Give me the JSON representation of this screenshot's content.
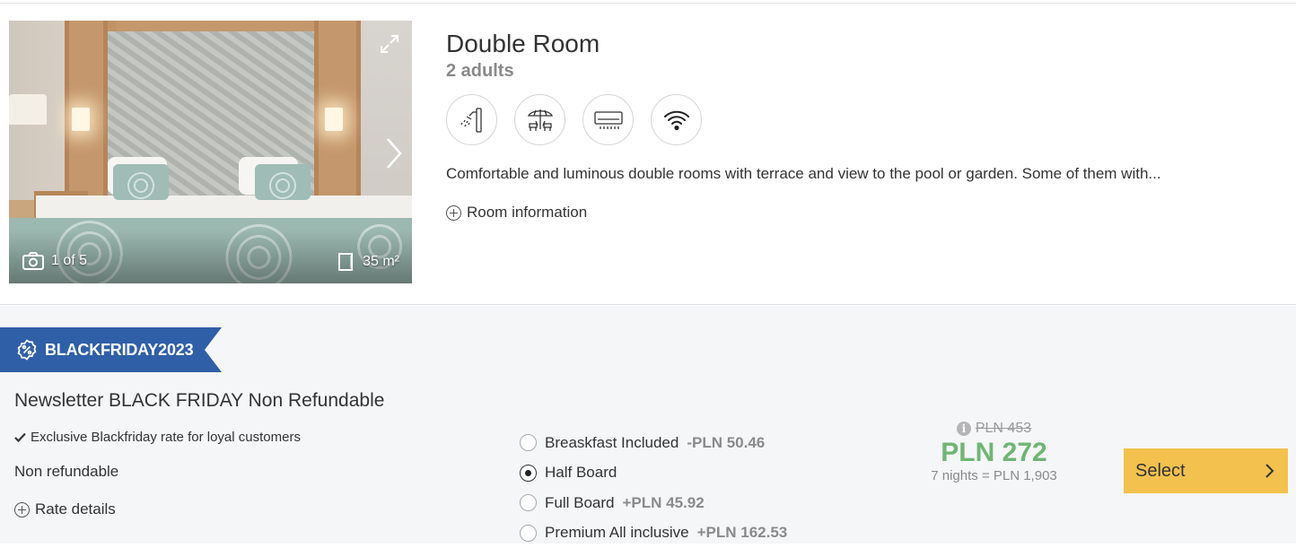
{
  "room": {
    "title": "Double Room",
    "occupancy": "2 adults",
    "gallery": {
      "counter": "1 of 5",
      "area": "35 m²"
    },
    "amenities": [
      "shower-icon",
      "terrace-icon",
      "air-conditioning-icon",
      "wifi-icon"
    ],
    "description": "Comfortable and luminous double rooms with terrace and view to the pool or garden.  Some of them with...",
    "info_link": "Room information"
  },
  "rate": {
    "promo_code": "BLACKFRIDAY2023",
    "promo_color": "#2f5fa7",
    "title": "Newsletter BLACK FRIDAY Non Refundable",
    "feature": "Exclusive Blackfriday rate for loyal customers",
    "policy": "Non refundable",
    "details_link": "Rate details",
    "boards": [
      {
        "label": "Breaskfast Included",
        "diff": "-PLN 50.46",
        "selected": false
      },
      {
        "label": "Half Board",
        "diff": "",
        "selected": true
      },
      {
        "label": "Full Board",
        "diff": "+PLN 45.92",
        "selected": false
      },
      {
        "label": "Premium All inclusive",
        "diff": "+PLN 162.53",
        "selected": false
      }
    ],
    "price": {
      "old": "PLN 453",
      "current": "PLN 272",
      "total": "7 nights = PLN 1,903",
      "current_color": "#6fb673"
    },
    "select_label": "Select",
    "select_color": "#f2c14e"
  }
}
